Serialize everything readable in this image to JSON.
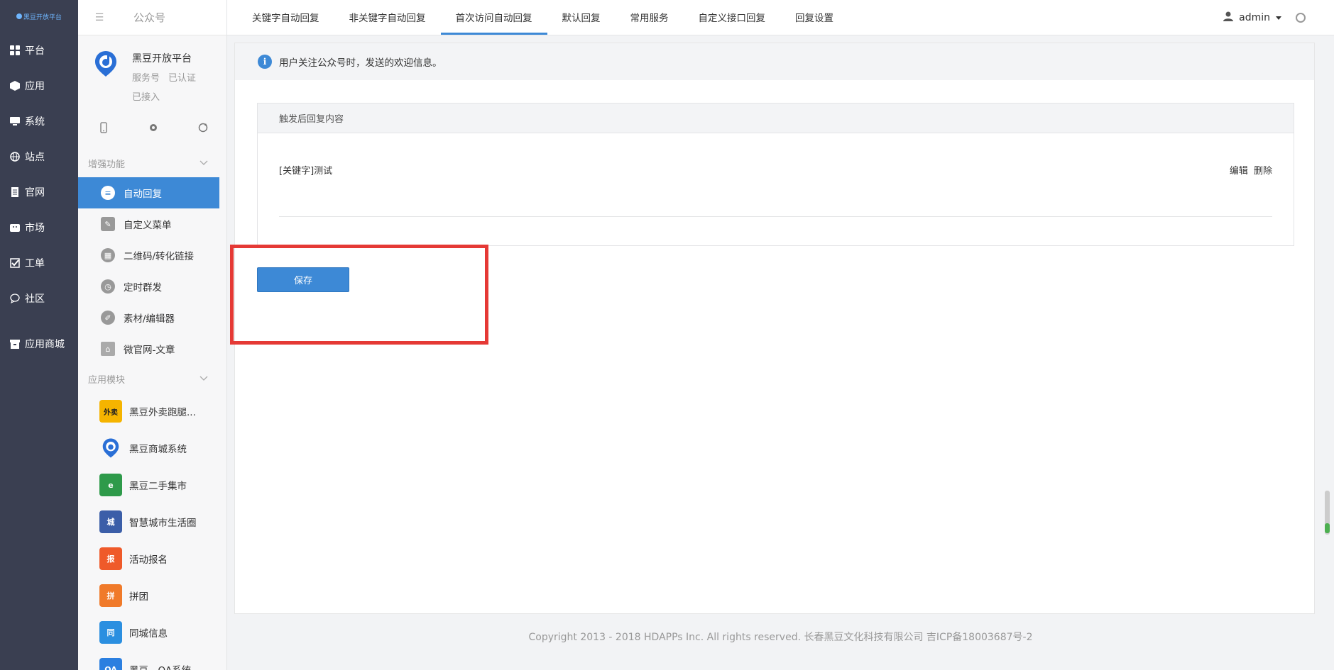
{
  "logo": {
    "text": "黑豆开放平台"
  },
  "leftnav": {
    "items": [
      {
        "label": "平台",
        "icon": "grid-icon"
      },
      {
        "label": "应用",
        "icon": "cube-icon"
      },
      {
        "label": "系统",
        "icon": "monitor-icon"
      },
      {
        "label": "站点",
        "icon": "globe-icon"
      },
      {
        "label": "官网",
        "icon": "document-icon"
      },
      {
        "label": "市场",
        "icon": "shop-icon"
      },
      {
        "label": "工单",
        "icon": "checkbox-icon"
      },
      {
        "label": "社区",
        "icon": "chat-icon"
      }
    ],
    "store": {
      "label": "应用商城",
      "icon": "store-icon"
    }
  },
  "sidebar": {
    "title": "公众号",
    "account": {
      "name": "黑豆开放平台",
      "type": "服务号",
      "verified": "已认证",
      "connected": "已接入"
    },
    "groups": [
      {
        "title": "增强功能",
        "items": [
          {
            "label": "自动回复",
            "icon": "chat-bubble-icon",
            "active": true
          },
          {
            "label": "自定义菜单",
            "icon": "edit-doc-icon"
          },
          {
            "label": "二维码/转化链接",
            "icon": "qrcode-icon"
          },
          {
            "label": "定时群发",
            "icon": "clock-icon"
          },
          {
            "label": "素材/编辑器",
            "icon": "pencil-icon"
          },
          {
            "label": "微官网-文章",
            "icon": "home-icon"
          }
        ]
      }
    ],
    "apps_title": "应用模块",
    "apps": [
      {
        "label": "黑豆外卖跑腿...",
        "color": "#f5b400",
        "glyph": "外卖"
      },
      {
        "label": "黑豆商城系统",
        "color": "#2a6fd6",
        "glyph": "d"
      },
      {
        "label": "黑豆二手集市",
        "color": "#2e9a4a",
        "glyph": "e"
      },
      {
        "label": "智慧城市生活圈",
        "color": "#3b5ea8",
        "glyph": "城"
      },
      {
        "label": "活动报名",
        "color": "#ef5a2a",
        "glyph": "报"
      },
      {
        "label": "拼团",
        "color": "#f07a2a",
        "glyph": "拼"
      },
      {
        "label": "同城信息",
        "color": "#2b8fe0",
        "glyph": "同"
      },
      {
        "label": "黑豆—OA系统",
        "color": "#2b7fe0",
        "glyph": "OA"
      }
    ]
  },
  "tabs": [
    {
      "label": "关键字自动回复"
    },
    {
      "label": "非关键字自动回复"
    },
    {
      "label": "首次访问自动回复",
      "active": true
    },
    {
      "label": "默认回复"
    },
    {
      "label": "常用服务"
    },
    {
      "label": "自定义接口回复"
    },
    {
      "label": "回复设置"
    }
  ],
  "user": {
    "name": "admin"
  },
  "notice": "用户关注公众号时，发送的欢迎信息。",
  "panel": {
    "title": "触发后回复内容",
    "row": {
      "text": "[关键字]测试",
      "edit": "编辑",
      "delete": "删除"
    }
  },
  "save_label": "保存",
  "footer": "Copyright 2013 - 2018 HDAPPs Inc. All rights reserved. 长春黑豆文化科技有限公司 吉ICP备18003687号-2"
}
